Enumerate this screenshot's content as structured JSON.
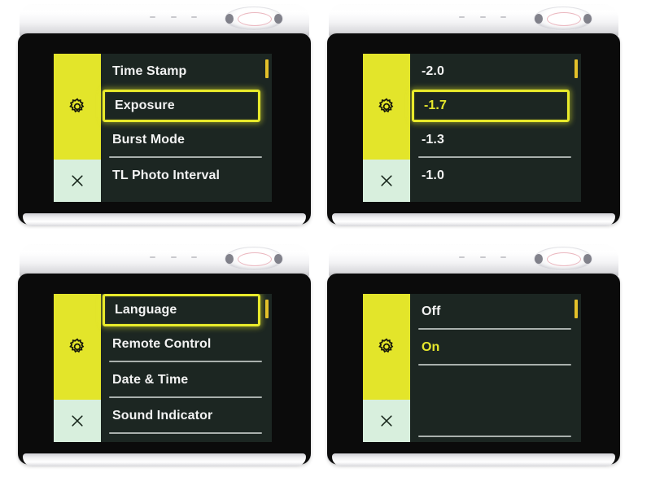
{
  "page": {
    "background_color": "#ffffff",
    "device_label": "action-camera"
  },
  "theme": {
    "accent_yellow": "#e3e52a",
    "selection_yellow": "#e8ea2b",
    "rail_close_green": "#d8efdd",
    "screen_bg": "#1c2622",
    "bezel_black": "#0b0b0b",
    "text_white": "#f2f2f2",
    "text_highlight": "#e6e72c",
    "separator": "#a9b0ad",
    "scrollbar": "#e3c02a"
  },
  "icons": {
    "gear": "gear-icon",
    "close": "close-x-icon",
    "mic_dots": "microphone-dots-icon",
    "shutter": "shutter-button-icon"
  },
  "panels": [
    {
      "id": "settings-menu",
      "position": "top-left",
      "rail": {
        "gear": "⚙",
        "close": "✕"
      },
      "scrollbar": true,
      "rows": [
        {
          "label": "Time Stamp",
          "selected": false,
          "separator": false,
          "highlight": false
        },
        {
          "label": "Exposure",
          "selected": true,
          "separator": false,
          "highlight": false
        },
        {
          "label": "Burst Mode",
          "selected": false,
          "separator": true,
          "highlight": false
        },
        {
          "label": "TL Photo Interval",
          "selected": false,
          "separator": false,
          "highlight": false
        }
      ]
    },
    {
      "id": "exposure-values",
      "position": "top-right",
      "rail": {
        "gear": "⚙",
        "close": "✕"
      },
      "scrollbar": true,
      "rows": [
        {
          "label": "-2.0",
          "selected": false,
          "separator": false,
          "highlight": false
        },
        {
          "label": "-1.7",
          "selected": true,
          "separator": false,
          "highlight": true
        },
        {
          "label": "-1.3",
          "selected": false,
          "separator": true,
          "highlight": false
        },
        {
          "label": "-1.0",
          "selected": false,
          "separator": false,
          "highlight": false
        }
      ]
    },
    {
      "id": "system-menu",
      "position": "bottom-left",
      "rail": {
        "gear": "⚙",
        "close": "✕"
      },
      "scrollbar": true,
      "rows": [
        {
          "label": "Language",
          "selected": true,
          "separator": false,
          "highlight": false
        },
        {
          "label": "Remote Control",
          "selected": false,
          "separator": true,
          "highlight": false
        },
        {
          "label": "Date & Time",
          "selected": false,
          "separator": true,
          "highlight": false
        },
        {
          "label": "Sound Indicator",
          "selected": false,
          "separator": true,
          "highlight": false
        }
      ]
    },
    {
      "id": "on-off-toggle",
      "position": "bottom-right",
      "rail": {
        "gear": "⚙",
        "close": "✕"
      },
      "scrollbar": true,
      "rows": [
        {
          "label": "Off",
          "selected": false,
          "separator": true,
          "highlight": false
        },
        {
          "label": "On",
          "selected": false,
          "separator": true,
          "highlight": true
        },
        {
          "label": "",
          "selected": false,
          "separator": false,
          "highlight": false
        },
        {
          "label": "",
          "selected": false,
          "separator": true,
          "highlight": false
        }
      ]
    }
  ]
}
